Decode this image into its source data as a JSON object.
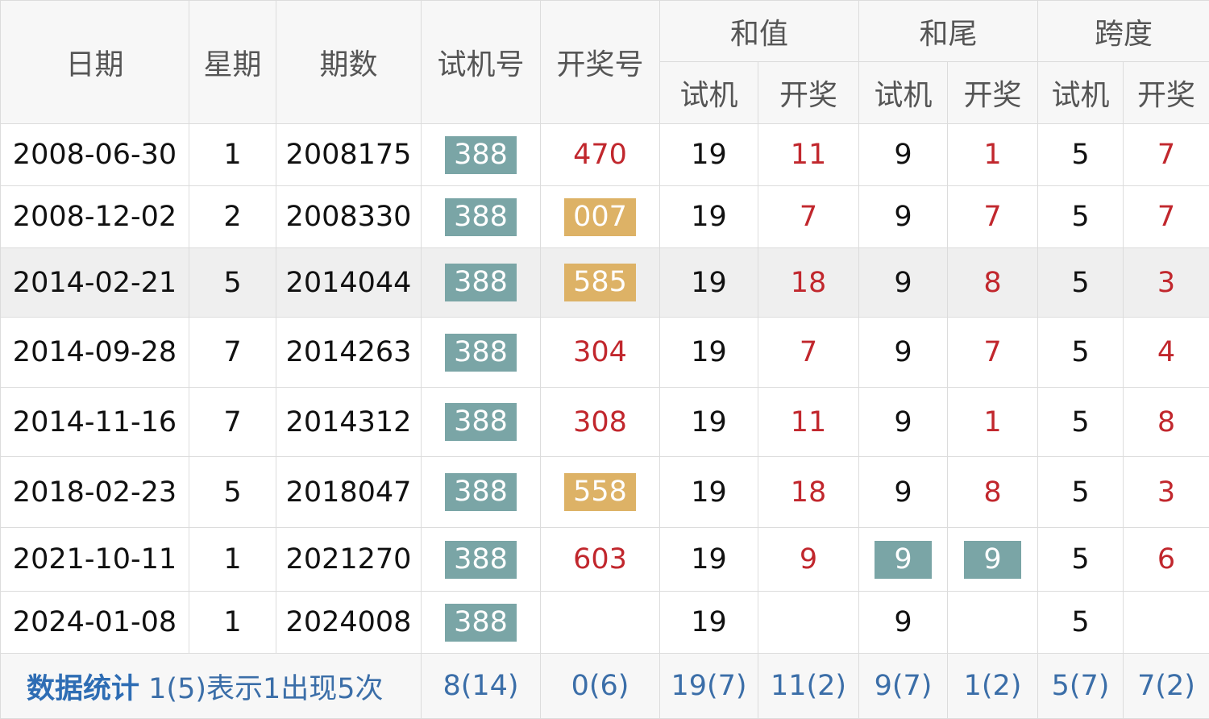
{
  "header": {
    "date": "日期",
    "weekday": "星期",
    "issue": "期数",
    "test_number": "试机号",
    "draw_number": "开奖号",
    "sum": "和值",
    "sum_tail": "和尾",
    "span": "跨度",
    "sub_test": "试机",
    "sub_draw": "开奖"
  },
  "rows": [
    {
      "date": "2008-06-30",
      "weekday": "1",
      "issue": "2008175",
      "test": "388",
      "draw": "470",
      "draw_style": "plain",
      "sum_test": "19",
      "sum_draw": "11",
      "tail_test": "9",
      "tail_draw": "1",
      "span_test": "5",
      "span_draw": "7"
    },
    {
      "date": "2008-12-02",
      "weekday": "2",
      "issue": "2008330",
      "test": "388",
      "draw": "007",
      "draw_style": "gold",
      "sum_test": "19",
      "sum_draw": "7",
      "tail_test": "9",
      "tail_draw": "7",
      "span_test": "5",
      "span_draw": "7"
    },
    {
      "date": "2014-02-21",
      "weekday": "5",
      "issue": "2014044",
      "test": "388",
      "draw": "585",
      "draw_style": "gold",
      "sum_test": "19",
      "sum_draw": "18",
      "tail_test": "9",
      "tail_draw": "8",
      "span_test": "5",
      "span_draw": "3"
    },
    {
      "date": "2014-09-28",
      "weekday": "7",
      "issue": "2014263",
      "test": "388",
      "draw": "304",
      "draw_style": "plain",
      "sum_test": "19",
      "sum_draw": "7",
      "tail_test": "9",
      "tail_draw": "7",
      "span_test": "5",
      "span_draw": "4"
    },
    {
      "date": "2014-11-16",
      "weekday": "7",
      "issue": "2014312",
      "test": "388",
      "draw": "308",
      "draw_style": "plain",
      "sum_test": "19",
      "sum_draw": "11",
      "tail_test": "9",
      "tail_draw": "1",
      "span_test": "5",
      "span_draw": "8"
    },
    {
      "date": "2018-02-23",
      "weekday": "5",
      "issue": "2018047",
      "test": "388",
      "draw": "558",
      "draw_style": "gold",
      "sum_test": "19",
      "sum_draw": "18",
      "tail_test": "9",
      "tail_draw": "8",
      "span_test": "5",
      "span_draw": "3"
    },
    {
      "date": "2021-10-11",
      "weekday": "1",
      "issue": "2021270",
      "test": "388",
      "draw": "603",
      "draw_style": "plain",
      "sum_test": "19",
      "sum_draw": "9",
      "tail_test": "9",
      "tail_draw": "9",
      "span_test": "5",
      "span_draw": "6"
    },
    {
      "date": "2024-01-08",
      "weekday": "1",
      "issue": "2024008",
      "test": "388",
      "draw": "",
      "draw_style": "plain",
      "sum_test": "19",
      "sum_draw": "",
      "tail_test": "9",
      "tail_draw": "",
      "span_test": "5",
      "span_draw": ""
    }
  ],
  "stats": {
    "label": "数据统计",
    "note": "1(5)表示1出现5次",
    "test_number": "8(14)",
    "draw_number": "0(6)",
    "sum_test": "19(7)",
    "sum_draw": "11(2)",
    "tail_test": "9(7)",
    "tail_draw": "1(2)",
    "span_test": "5(7)",
    "span_draw": "7(2)"
  },
  "colors": {
    "teal_badge": "#7aa5a6",
    "gold_badge": "#ddb266",
    "red_text": "#c1272d",
    "stats_blue": "#2e6db4"
  }
}
